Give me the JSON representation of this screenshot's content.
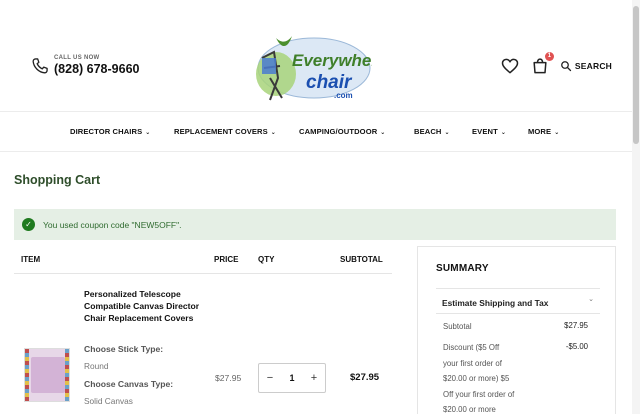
{
  "header": {
    "call_label": "CALL US NOW",
    "phone": "(828) 678-9660",
    "logo_line1": "Everywhere",
    "logo_line2": "chair",
    "logo_line3": ".com",
    "cart_count": "1",
    "search_label": "SEARCH",
    "brand_colors": {
      "green": "#3f7f2a",
      "blue": "#1b4fb0"
    }
  },
  "nav": {
    "items": [
      {
        "label": "DIRECTOR CHAIRS"
      },
      {
        "label": "REPLACEMENT COVERS"
      },
      {
        "label": "CAMPING/OUTDOOR"
      },
      {
        "label": "BEACH"
      },
      {
        "label": "EVENT"
      },
      {
        "label": "MORE"
      }
    ]
  },
  "page_title": "Shopping Cart",
  "message": {
    "text": "You used coupon code \"NEW5OFF\".",
    "icon": "check-circle-icon",
    "color": "#2f6b2f"
  },
  "cart": {
    "columns": {
      "item": "ITEM",
      "price": "PRICE",
      "qty": "QTY",
      "subtotal": "SUBTOTAL"
    },
    "rows": [
      {
        "name": "Personalized Telescope Compatible Canvas Director Chair Replacement Covers",
        "options": [
          {
            "label": "Choose Stick Type:",
            "value": "Round"
          },
          {
            "label": "Choose Canvas Type:",
            "value": "Solid Canvas"
          }
        ],
        "price": "$27.95",
        "qty": "1",
        "subtotal": "$27.95"
      }
    ]
  },
  "summary": {
    "title": "SUMMARY",
    "shipping_label": "Estimate Shipping and Tax",
    "subtotal_label": "Subtotal",
    "subtotal_value": "$27.95",
    "discount_label_lines": [
      "Discount ($5 Off",
      "your first order of",
      "$20.00 or more) $5",
      "Off your first order of",
      "$20.00 or more"
    ],
    "discount_value": "-$5.00"
  }
}
